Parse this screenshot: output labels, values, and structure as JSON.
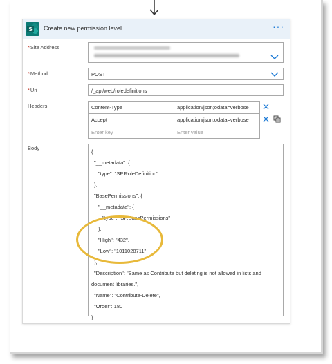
{
  "card": {
    "title": "Create new permission level",
    "more_icon": "ellipsis-icon"
  },
  "fields": {
    "site_address": {
      "label": "Site Address",
      "required": true
    },
    "method": {
      "label": "Method",
      "required": true,
      "value": "POST"
    },
    "uri": {
      "label": "Uri",
      "required": true,
      "value": "/_api/web/roledefinitions"
    },
    "headers": {
      "label": "Headers",
      "rows": [
        {
          "key": "Content-Type",
          "value": "application/json;odata=verbose"
        },
        {
          "key": "Accept",
          "value": "application/json;odata=verbose"
        }
      ],
      "key_placeholder": "Enter key",
      "value_placeholder": "Enter value"
    },
    "body": {
      "label": "Body",
      "lines": [
        "{",
        "\"__metadata\": {",
        "\"type\": \"SP.RoleDefinition\"",
        "},",
        "\"BasePermissions\": {",
        "\"__metadata\": {",
        "\"type\": \"SP.BasePermissions\"",
        "},",
        "\"High\": \"432\",",
        "\"Low\": \"1011028711\"",
        "},",
        "\"Description\": \"Same as Contribute but deleting is not allowed in lists and",
        "document libraries.\",",
        "\"Name\": \"Contribute-Delete\",",
        "\"Order\": 180",
        "}"
      ]
    }
  },
  "colors": {
    "accent": "#1e7bd6",
    "required": "#c0392b",
    "highlight": "#e8b93a",
    "header_bg": "#e9f1f9",
    "sharepoint": "#0b7a75"
  }
}
